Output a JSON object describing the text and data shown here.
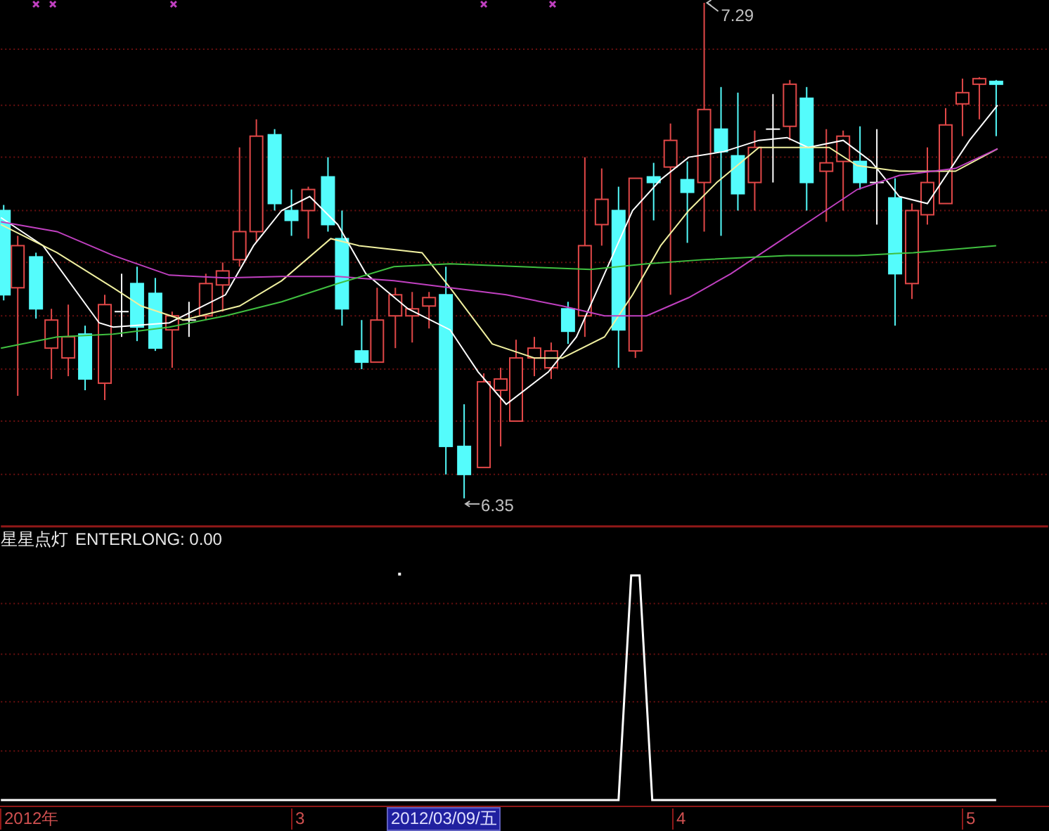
{
  "price_panel": {
    "annotations": [
      {
        "kind": "high",
        "text": "7.29"
      },
      {
        "kind": "low",
        "text": "6.35"
      }
    ]
  },
  "indicator_panel": {
    "name": "星星点灯",
    "reading": "ENTERLONG: 0.00"
  },
  "time_axis": {
    "labels": [
      {
        "kind": "tick",
        "text": "2012年"
      },
      {
        "kind": "tick",
        "text": "3"
      },
      {
        "kind": "cursor",
        "text": "2012/03/09/五"
      },
      {
        "kind": "tick",
        "text": "4"
      },
      {
        "kind": "tick",
        "text": "5"
      }
    ]
  }
}
